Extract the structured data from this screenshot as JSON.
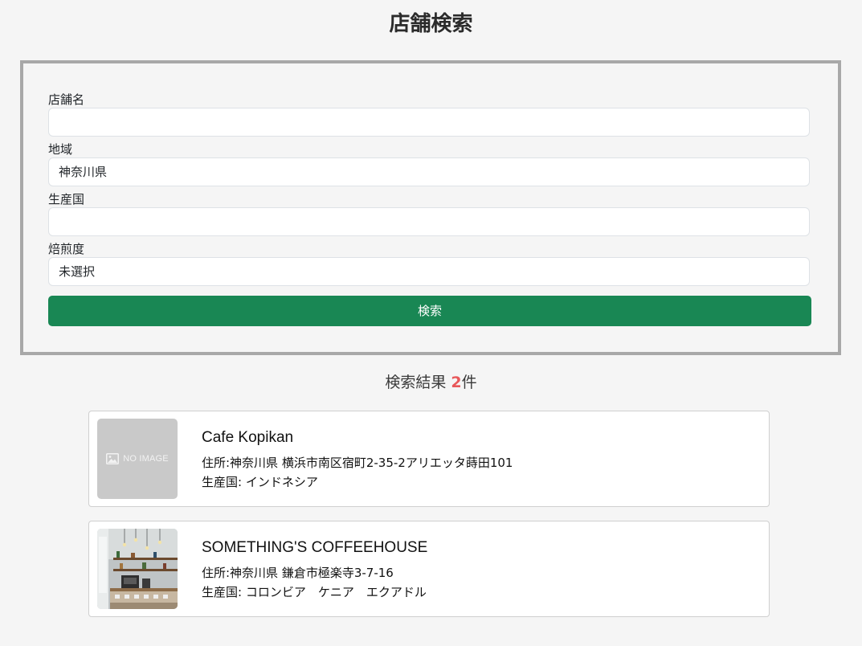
{
  "header": {
    "title": "店舗検索"
  },
  "form": {
    "store_name": {
      "label": "店舗名",
      "value": ""
    },
    "region": {
      "label": "地域",
      "value": "神奈川県"
    },
    "origin": {
      "label": "生産国",
      "value": ""
    },
    "roast": {
      "label": "焙煎度",
      "value": "未選択"
    },
    "submit_label": "検索"
  },
  "results": {
    "heading_prefix": "検索結果 ",
    "count": "2",
    "heading_suffix": "件",
    "items": [
      {
        "name": "Cafe Kopikan",
        "address": "住所:神奈川県 横浜市南区宿町2-35-2アリエッタ蒔田101",
        "origin": "生産国: インドネシア",
        "image_text": "NO IMAGE"
      },
      {
        "name": "SOMETHING'S COFFEEHOUSE",
        "address": "住所:神奈川県 鎌倉市極楽寺3-7-16",
        "origin": "生産国: コロンビア　ケニア　エクアドル"
      }
    ]
  },
  "colors": {
    "accent_button": "#198754",
    "count_highlight": "#e8585a",
    "panel_border": "#a8a8a8"
  }
}
